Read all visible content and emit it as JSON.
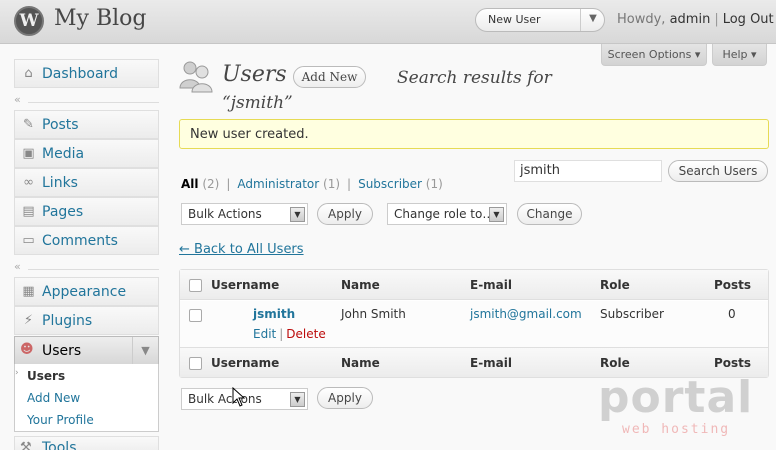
{
  "header": {
    "site_title": "My Blog",
    "favorite_action": "New User",
    "howdy_prefix": "Howdy,",
    "username": "admin",
    "logout": "Log Out"
  },
  "sidebar": {
    "items": [
      {
        "label": "Dashboard",
        "icon": "dashboard-icon"
      },
      {
        "label": "Posts",
        "icon": "pin-icon"
      },
      {
        "label": "Media",
        "icon": "media-icon"
      },
      {
        "label": "Links",
        "icon": "link-icon"
      },
      {
        "label": "Pages",
        "icon": "pages-icon"
      },
      {
        "label": "Comments",
        "icon": "comments-icon"
      },
      {
        "label": "Appearance",
        "icon": "appearance-icon"
      },
      {
        "label": "Plugins",
        "icon": "plugin-icon"
      },
      {
        "label": "Users",
        "icon": "users-icon"
      },
      {
        "label": "Tools",
        "icon": "tools-icon"
      }
    ],
    "users_submenu": [
      "Users",
      "Add New",
      "Your Profile"
    ]
  },
  "tabs": {
    "screen_options": "Screen Options",
    "help": "Help"
  },
  "page": {
    "title": "Users",
    "add_new": "Add New",
    "search_results_for": "Search results for",
    "search_term": "“jsmith”",
    "notice": "New user created."
  },
  "filters": {
    "all": "All",
    "all_count": "(2)",
    "administrator": "Administrator",
    "administrator_count": "(1)",
    "subscriber": "Subscriber",
    "subscriber_count": "(1)"
  },
  "search": {
    "value": "jsmith",
    "button": "Search Users"
  },
  "actions": {
    "bulk_actions": "Bulk Actions",
    "apply": "Apply",
    "change_role": "Change role to…",
    "change": "Change",
    "back_link": "← Back to All Users"
  },
  "table": {
    "columns": [
      "Username",
      "Name",
      "E-mail",
      "Role",
      "Posts"
    ],
    "rows": [
      {
        "username": "jsmith",
        "name": "John Smith",
        "email": "jsmith@gmail.com",
        "role": "Subscriber",
        "posts": "0",
        "edit": "Edit",
        "delete": "Delete"
      }
    ]
  },
  "watermark": {
    "brand": "portal",
    "tagline": "web hosting"
  }
}
